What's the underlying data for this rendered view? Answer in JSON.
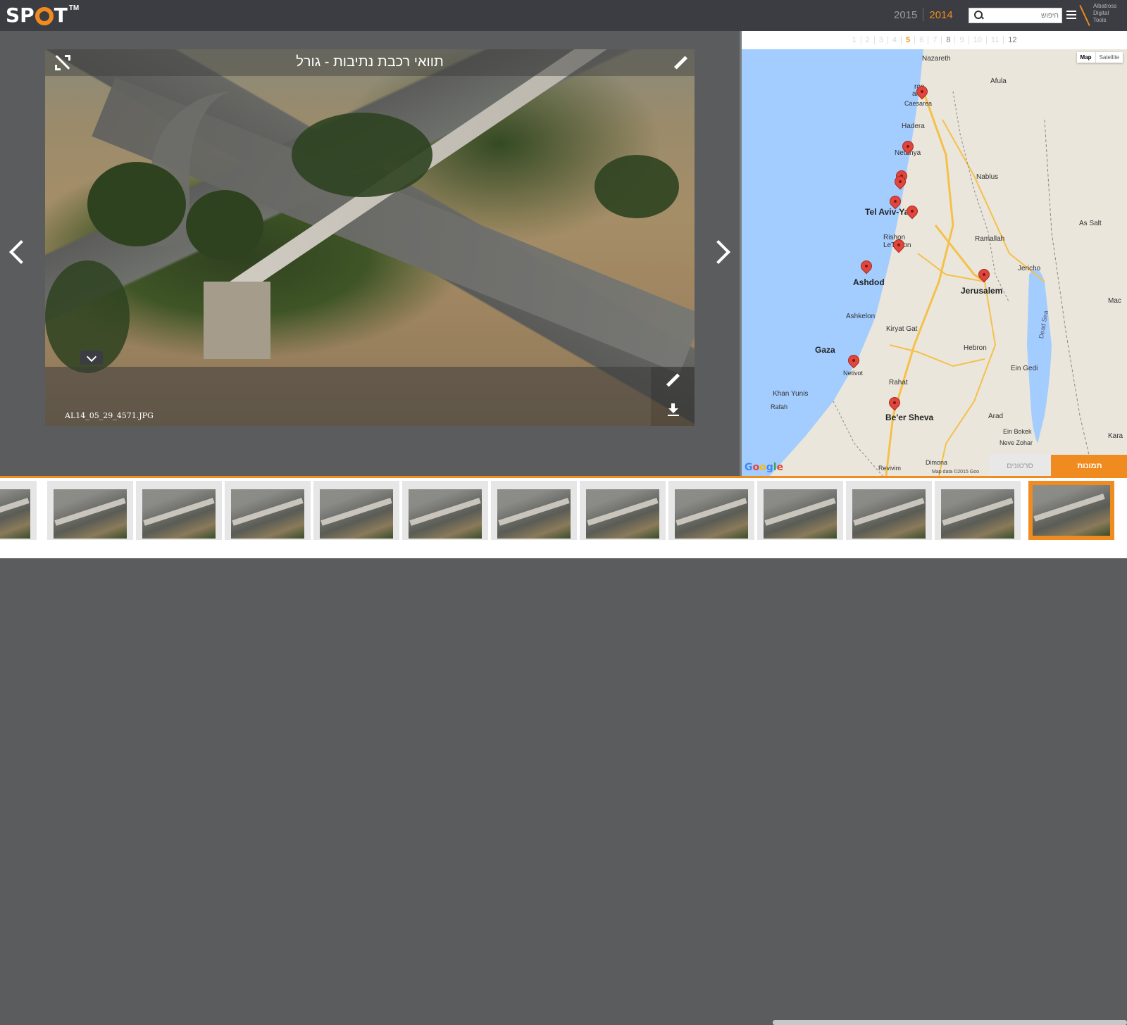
{
  "header": {
    "logo_text": "SP",
    "logo_text_end": "T",
    "logo_tm": "TM",
    "years": [
      "2015",
      "2014"
    ],
    "active_year": "2014",
    "search_placeholder": "חיפוש",
    "brand_lines": [
      "Albatross",
      "Digital",
      "Tools"
    ],
    "accent_color": "#f08c1f"
  },
  "viewer": {
    "title": "תוואי רכבת נתיבות - גורל",
    "filename": "AL14_05_29_4571.JPG"
  },
  "ruler": {
    "marks": [
      "1",
      "2",
      "3",
      "4",
      "5",
      "6",
      "7",
      "8",
      "9",
      "10",
      "11",
      "12"
    ],
    "active": "5"
  },
  "map": {
    "type_buttons": [
      "Map",
      "Satellite"
    ],
    "cities": [
      {
        "name": "Nazareth",
        "big": false
      },
      {
        "name": "Afula",
        "big": false
      },
      {
        "name": "ron",
        "big": false
      },
      {
        "name": "akov",
        "big": false
      },
      {
        "name": "Caesarea",
        "big": false
      },
      {
        "name": "Hadera",
        "big": false
      },
      {
        "name": "Netanya",
        "big": false
      },
      {
        "name": "Nablus",
        "big": false
      },
      {
        "name": "Tel Aviv-Yafo",
        "big": true
      },
      {
        "name": "Rishon LeTsiyon",
        "big": false
      },
      {
        "name": "Ramallah",
        "big": false
      },
      {
        "name": "Ashdod",
        "big": true
      },
      {
        "name": "Jerusalem",
        "big": true
      },
      {
        "name": "Jericho",
        "big": false
      },
      {
        "name": "As Salt",
        "big": false
      },
      {
        "name": "Ashkelon",
        "big": false
      },
      {
        "name": "Kiryat Gat",
        "big": false
      },
      {
        "name": "Hebron",
        "big": false
      },
      {
        "name": "Gaza",
        "big": true
      },
      {
        "name": "Netivot",
        "big": false
      },
      {
        "name": "Rahat",
        "big": false
      },
      {
        "name": "Ein Gedi",
        "big": false
      },
      {
        "name": "Khan Yunis",
        "big": false
      },
      {
        "name": "Rafah",
        "big": false
      },
      {
        "name": "Be'er Sheva",
        "big": true
      },
      {
        "name": "Arad",
        "big": false
      },
      {
        "name": "Ein Bokek",
        "big": false
      },
      {
        "name": "Neve Zohar",
        "big": false
      },
      {
        "name": "Dimona",
        "big": false
      },
      {
        "name": "Revivim",
        "big": false
      },
      {
        "name": "Dead Sea",
        "big": false
      },
      {
        "name": "Mac",
        "big": false
      },
      {
        "name": "Kara",
        "big": false
      }
    ],
    "google": "Google",
    "attribution": "Map data ©2015 Goo"
  },
  "tabs": {
    "videos": "סרטונים",
    "photos": "תמונות",
    "active": "photos"
  },
  "filmstrip": {
    "count": 13,
    "active_index": 12
  }
}
